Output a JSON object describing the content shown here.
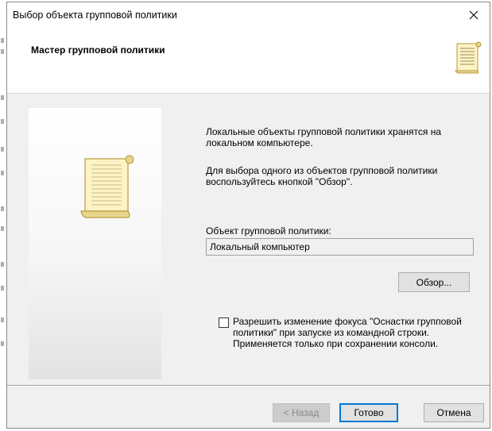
{
  "window": {
    "title": "Выбор объекта групповой политики",
    "close_symbol": "✕"
  },
  "header": {
    "title": "Мастер групповой политики",
    "icon": "scroll-icon"
  },
  "content": {
    "side_icon": "scroll-icon",
    "text_1": "Локальные объекты групповой политики хранятся на локальном компьютере.",
    "text_2": "Для выбора одного из объектов групповой политики воспользуйтесь кнопкой \"Обзор\".",
    "gpo_label": "Объект групповой политики:",
    "gpo_value": "Локальный компьютер",
    "browse_label": "Обзор...",
    "checkbox_checked": false,
    "checkbox_label": "Разрешить изменение фокуса \"Оснастки групповой политики\" при запуске из командной строки. Применяется только при сохранении консоли."
  },
  "footer": {
    "back_label": "< Назад",
    "finish_label": "Готово",
    "cancel_label": "Отмена"
  },
  "colors": {
    "dialog_bg": "#f0f0f0",
    "header_bg": "#ffffff",
    "focus_border": "#0078d7",
    "scroll_fill": "#fdf3c4"
  }
}
